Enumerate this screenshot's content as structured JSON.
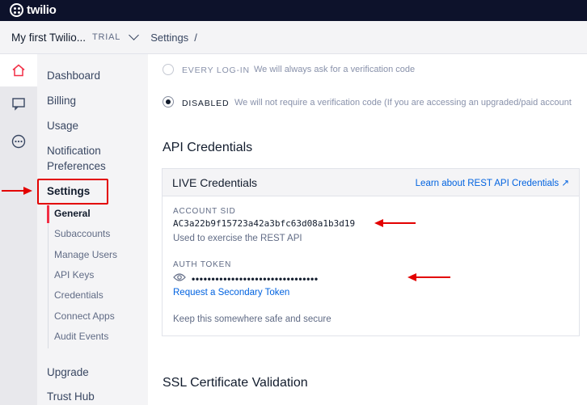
{
  "topbar": {
    "logo_text": "twilio"
  },
  "subbar": {
    "project_name": "My first Twilio...",
    "badge": "TRIAL",
    "breadcrumb": "Settings",
    "separator": "/"
  },
  "nav": {
    "items": [
      "Dashboard",
      "Billing",
      "Usage",
      "Notification",
      "Preferences",
      "Settings",
      "Upgrade",
      "Trust Hub"
    ],
    "sub_items": [
      "General",
      "Subaccounts",
      "Manage Users",
      "API Keys",
      "Credentials",
      "Connect Apps",
      "Audit Events"
    ]
  },
  "options": [
    {
      "label": "EVERY LOG-IN",
      "desc": "We will always ask for a verification code",
      "selected": false
    },
    {
      "label": "DISABLED",
      "desc": "We will not require a verification code (If you are accessing an upgraded/paid account",
      "selected": true
    }
  ],
  "api": {
    "heading": "API Credentials",
    "card_title": "LIVE Credentials",
    "card_link": "Learn about REST API Credentials ↗",
    "sid_label": "ACCOUNT SID",
    "sid_value": "AC3a22b9f15723a42a3bfc63d08a1b3d19",
    "sid_help": "Used to exercise the REST API",
    "token_label": "AUTH TOKEN",
    "token_mask": "••••••••••••••••••••••••••••••••",
    "token_link": "Request a Secondary Token",
    "token_help": "Keep this somewhere safe and secure"
  },
  "ssl": {
    "heading": "SSL Certificate Validation"
  },
  "colors": {
    "annotation": "#e30000",
    "link": "#0263e0",
    "topbar": "#0d122b"
  }
}
